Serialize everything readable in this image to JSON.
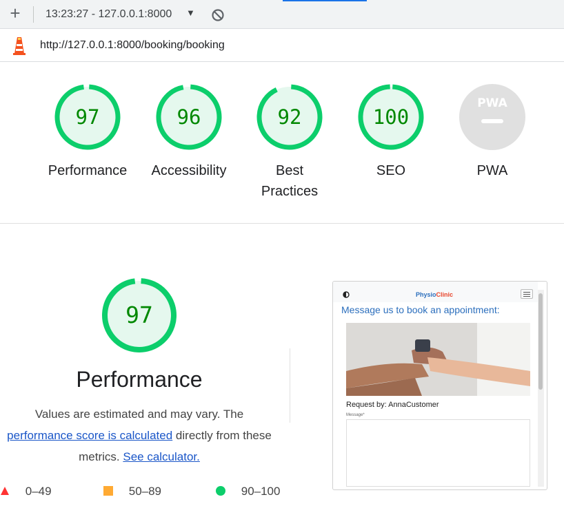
{
  "toolbar": {
    "session_label": "13:23:27 - 127.0.0.1:8000",
    "new_icon": "plus-icon",
    "dropdown_icon": "caret-down-icon",
    "clear_icon": "no-entry-icon"
  },
  "url_bar": {
    "icon": "lighthouse-icon",
    "url": "http://127.0.0.1:8000/booking/booking"
  },
  "categories": [
    {
      "label": "Performance",
      "score": "97",
      "fraction": 0.97
    },
    {
      "label": "Accessibility",
      "score": "96",
      "fraction": 0.96
    },
    {
      "label": "Best Practices",
      "score": "92",
      "fraction": 0.92
    },
    {
      "label": "SEO",
      "score": "100",
      "fraction": 1.0
    },
    {
      "label": "PWA",
      "badge": "PWA"
    }
  ],
  "performance": {
    "score": "97",
    "fraction": 0.97,
    "title": "Performance",
    "desc_part1": "Values are estimated and may vary. The",
    "link1": "performance score is calculated",
    "desc_part2": "directly from these metrics.",
    "link2": "See calculator."
  },
  "legend": [
    {
      "range": "0–49",
      "shape": "triangle",
      "color": "#ff3333"
    },
    {
      "range": "50–89",
      "shape": "square",
      "color": "#ffaa33"
    },
    {
      "range": "90–100",
      "shape": "circle",
      "color": "#0cce6b"
    }
  ],
  "screenshot": {
    "brand_part1": "Physio",
    "brand_part2": "Clinic",
    "heading": "Message us to book an appointment:",
    "request_label": "Request by: AnnaCustomer",
    "message_label": "Message*"
  },
  "colors": {
    "pass": "#0cce6b",
    "pass_text": "#008800",
    "pass_bg": "#e5f8ee",
    "pwa_gray": "#e0e0e0",
    "link": "#1a56c8"
  }
}
